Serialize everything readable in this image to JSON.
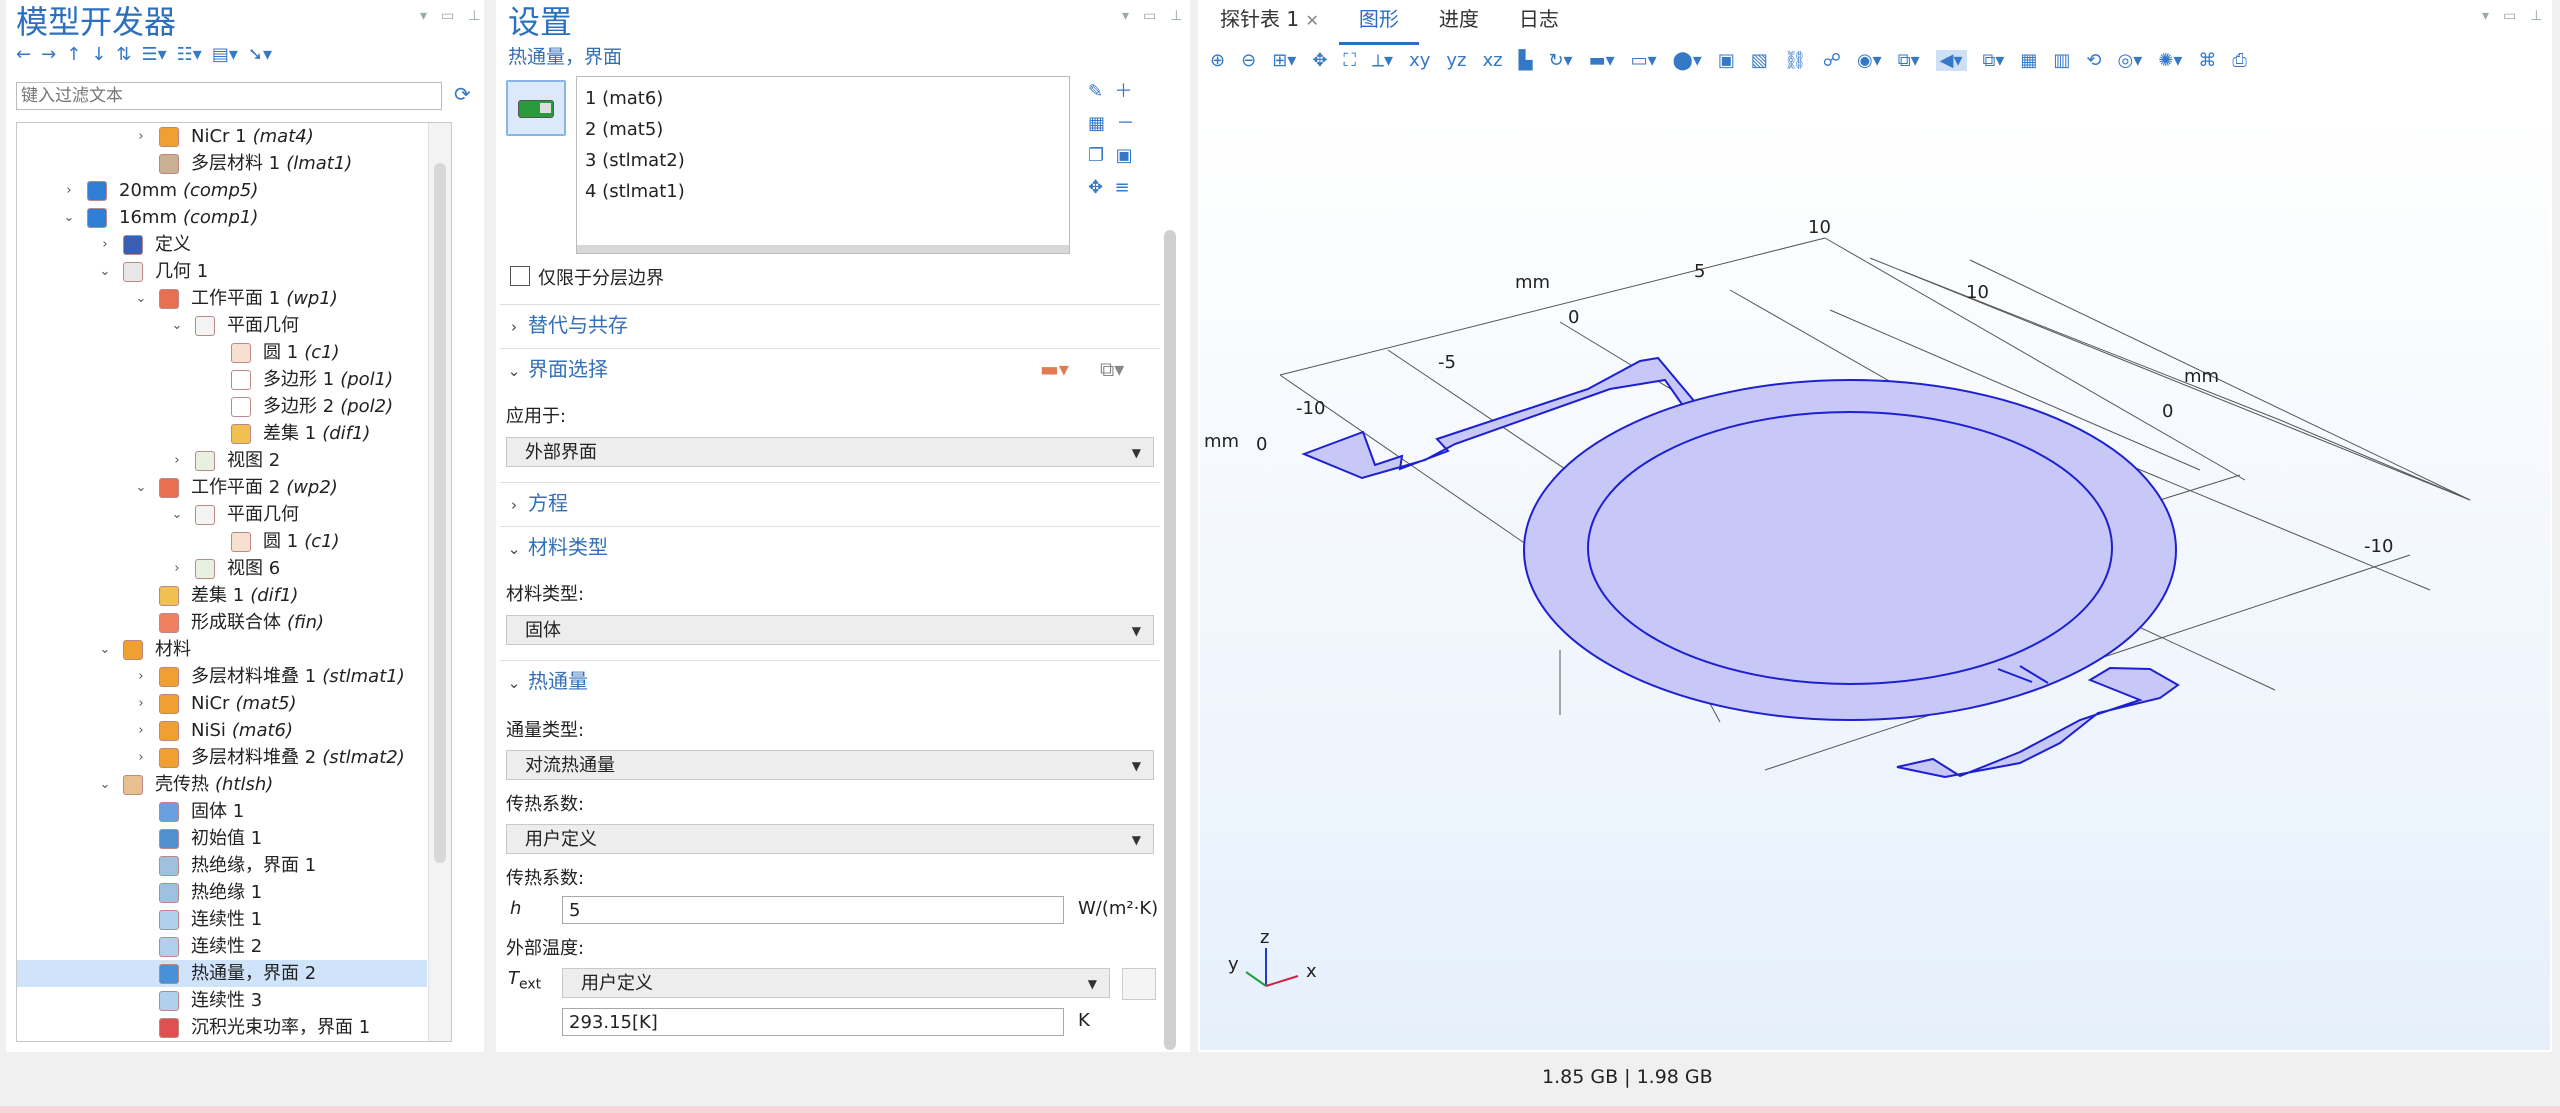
{
  "model_builder": {
    "title": "模型开发器",
    "filter_placeholder": "键入过滤文本",
    "tree": [
      {
        "indent": 3,
        "tw": "›",
        "icon": "mat-icon",
        "label": "NiCr 1",
        "tag": "(mat4)"
      },
      {
        "indent": 3,
        "tw": "",
        "icon": "layered-mat-icon",
        "label": "多层材料 1",
        "tag": "(lmat1)"
      },
      {
        "indent": 1,
        "tw": "›",
        "icon": "component-icon",
        "label": "20mm",
        "tag": "(comp5)"
      },
      {
        "indent": 1,
        "tw": "⌄",
        "icon": "component-icon",
        "label": "16mm",
        "tag": "(comp1)"
      },
      {
        "indent": 2,
        "tw": "›",
        "icon": "definitions-icon",
        "label": "定义",
        "tag": ""
      },
      {
        "indent": 2,
        "tw": "⌄",
        "icon": "geometry-icon",
        "label": "几何 1",
        "tag": ""
      },
      {
        "indent": 3,
        "tw": "⌄",
        "icon": "workplane-icon",
        "label": "工作平面 1",
        "tag": "(wp1)"
      },
      {
        "indent": 4,
        "tw": "⌄",
        "icon": "plane-geometry-icon",
        "label": "平面几何",
        "tag": ""
      },
      {
        "indent": 5,
        "tw": "",
        "icon": "circle-icon",
        "label": "圆 1",
        "tag": "(c1)"
      },
      {
        "indent": 5,
        "tw": "",
        "icon": "polygon-icon",
        "label": "多边形 1",
        "tag": "(pol1)"
      },
      {
        "indent": 5,
        "tw": "",
        "icon": "polygon-icon",
        "label": "多边形 2",
        "tag": "(pol2)"
      },
      {
        "indent": 5,
        "tw": "",
        "icon": "difference-icon",
        "label": "差集 1",
        "tag": "(dif1)"
      },
      {
        "indent": 4,
        "tw": "›",
        "icon": "view-icon",
        "label": "视图 2",
        "tag": ""
      },
      {
        "indent": 3,
        "tw": "⌄",
        "icon": "workplane-icon",
        "label": "工作平面 2",
        "tag": "(wp2)"
      },
      {
        "indent": 4,
        "tw": "⌄",
        "icon": "plane-geometry-icon",
        "label": "平面几何",
        "tag": ""
      },
      {
        "indent": 5,
        "tw": "",
        "icon": "circle-icon",
        "label": "圆 1",
        "tag": "(c1)"
      },
      {
        "indent": 4,
        "tw": "›",
        "icon": "view-icon",
        "label": "视图 6",
        "tag": ""
      },
      {
        "indent": 3,
        "tw": "",
        "icon": "difference-icon",
        "label": "差集 1",
        "tag": "(dif1)"
      },
      {
        "indent": 3,
        "tw": "",
        "icon": "union-icon",
        "label": "形成联合体",
        "tag": "(fin)"
      },
      {
        "indent": 2,
        "tw": "⌄",
        "icon": "materials-icon",
        "label": "材料",
        "tag": ""
      },
      {
        "indent": 3,
        "tw": "›",
        "icon": "mat-icon",
        "label": "多层材料堆叠 1",
        "tag": "(stlmat1)"
      },
      {
        "indent": 3,
        "tw": "›",
        "icon": "mat-icon",
        "label": "NiCr",
        "tag": "(mat5)"
      },
      {
        "indent": 3,
        "tw": "›",
        "icon": "mat-icon",
        "label": "NiSi",
        "tag": "(mat6)"
      },
      {
        "indent": 3,
        "tw": "›",
        "icon": "mat-icon",
        "label": "多层材料堆叠 2",
        "tag": "(stlmat2)"
      },
      {
        "indent": 2,
        "tw": "⌄",
        "icon": "shell-heat-icon",
        "label": "壳传热",
        "tag": "(htlsh)"
      },
      {
        "indent": 3,
        "tw": "",
        "icon": "solid-icon",
        "label": "固体 1",
        "tag": ""
      },
      {
        "indent": 3,
        "tw": "",
        "icon": "init-icon",
        "label": "初始值 1",
        "tag": ""
      },
      {
        "indent": 3,
        "tw": "",
        "icon": "insulation-icon",
        "label": "热绝缘，界面 1",
        "tag": ""
      },
      {
        "indent": 3,
        "tw": "",
        "icon": "insulation-icon",
        "label": "热绝缘 1",
        "tag": ""
      },
      {
        "indent": 3,
        "tw": "",
        "icon": "continuity-icon",
        "label": "连续性 1",
        "tag": ""
      },
      {
        "indent": 3,
        "tw": "",
        "icon": "continuity-icon",
        "label": "连续性 2",
        "tag": ""
      },
      {
        "indent": 3,
        "tw": "",
        "icon": "heat-flux-icon",
        "label": "热通量，界面 2",
        "tag": "",
        "selected": true
      },
      {
        "indent": 3,
        "tw": "",
        "icon": "continuity-icon",
        "label": "连续性 3",
        "tag": ""
      },
      {
        "indent": 3,
        "tw": "",
        "icon": "beam-power-icon",
        "label": "沉积光束功率，界面 1",
        "tag": ""
      }
    ]
  },
  "settings": {
    "title": "设置",
    "subtitle": "热通量，界面",
    "selection_list": [
      "1 (mat6)",
      "2 (mat5)",
      "3 (stlmat2)",
      "4 (stlmat1)"
    ],
    "checkbox_label": "仅限于分层边界",
    "sections": {
      "override": "替代与共存",
      "interface_selection": "界面选择",
      "equation": "方程",
      "material_type": "材料类型",
      "heat_flux": "热通量"
    },
    "apply_to_label": "应用于:",
    "apply_to_value": "外部界面",
    "material_type_label": "材料类型:",
    "material_type_value": "固体",
    "flux_type_label": "通量类型:",
    "flux_type_value": "对流热通量",
    "htc_label_1": "传热系数:",
    "htc_source_value": "用户定义",
    "htc_label_2": "传热系数:",
    "h_symbol": "h",
    "h_value": "5",
    "h_unit": "W/(m²·K)",
    "text_label": "外部温度:",
    "text_symbol": "T",
    "text_subscript": "ext",
    "text_source_value": "用户定义",
    "text_value": "293.15[K]",
    "text_unit": "K"
  },
  "graphics": {
    "tabs": [
      "探针表 1",
      "图形",
      "进度",
      "日志"
    ],
    "active_tab": "图形",
    "axis_labels": {
      "left_ticks": [
        "10",
        "5",
        "0",
        "-5",
        "-10"
      ],
      "left_unit": "mm",
      "left_zero": "0",
      "left_unit2": "mm",
      "right_ticks": [
        "10",
        "0",
        "-10"
      ],
      "right_unit": "mm"
    },
    "triad": {
      "x": "x",
      "y": "y",
      "z": "z"
    },
    "fill_color": "#c7c8f8",
    "edge_color": "#1d1fd0"
  },
  "status": {
    "memory": "1.85 GB | 1.98 GB"
  }
}
